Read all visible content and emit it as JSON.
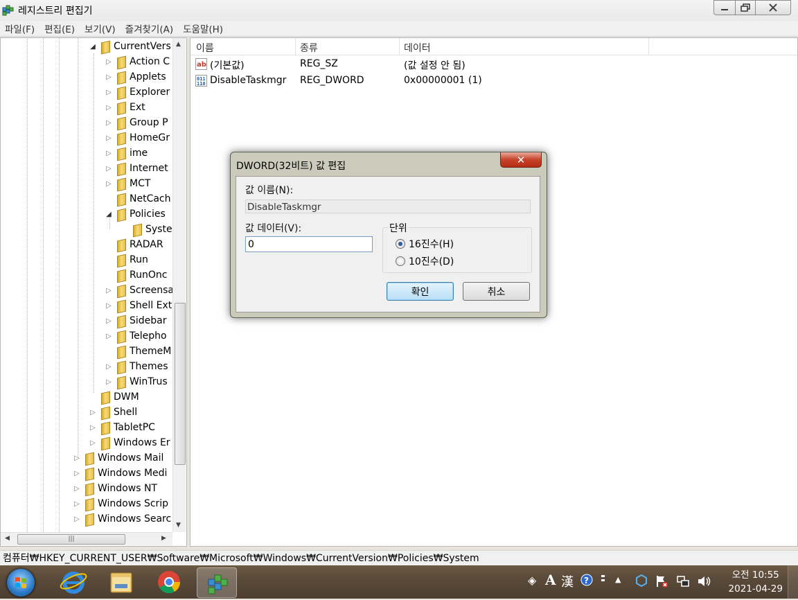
{
  "window": {
    "title": "레지스트리 편집기"
  },
  "menu": [
    "파일(F)",
    "편집(E)",
    "보기(V)",
    "즐겨찾기(A)",
    "도움말(H)"
  ],
  "tree": {
    "items": [
      {
        "label": "CurrentVers",
        "level": 2,
        "state": "expanded"
      },
      {
        "label": "Action C",
        "level": 3,
        "state": "collapsed"
      },
      {
        "label": "Applets",
        "level": 3,
        "state": "collapsed"
      },
      {
        "label": "Explorer",
        "level": 3,
        "state": "collapsed"
      },
      {
        "label": "Ext",
        "level": 3,
        "state": "collapsed"
      },
      {
        "label": "Group P",
        "level": 3,
        "state": "collapsed"
      },
      {
        "label": "HomeGr",
        "level": 3,
        "state": "collapsed"
      },
      {
        "label": "ime",
        "level": 3,
        "state": "collapsed"
      },
      {
        "label": "Internet",
        "level": 3,
        "state": "collapsed"
      },
      {
        "label": "MCT",
        "level": 3,
        "state": "collapsed"
      },
      {
        "label": "NetCach",
        "level": 3,
        "state": "none"
      },
      {
        "label": "Policies",
        "level": 3,
        "state": "expanded"
      },
      {
        "label": "Syste",
        "level": 4,
        "state": "none",
        "selected": true
      },
      {
        "label": "RADAR",
        "level": 3,
        "state": "none"
      },
      {
        "label": "Run",
        "level": 3,
        "state": "none"
      },
      {
        "label": "RunOnc",
        "level": 3,
        "state": "none"
      },
      {
        "label": "Screensa",
        "level": 3,
        "state": "collapsed"
      },
      {
        "label": "Shell Ext",
        "level": 3,
        "state": "collapsed"
      },
      {
        "label": "Sidebar",
        "level": 3,
        "state": "collapsed"
      },
      {
        "label": "Telepho",
        "level": 3,
        "state": "collapsed"
      },
      {
        "label": "ThemeM",
        "level": 3,
        "state": "none"
      },
      {
        "label": "Themes",
        "level": 3,
        "state": "collapsed"
      },
      {
        "label": "WinTrus",
        "level": 3,
        "state": "collapsed"
      },
      {
        "label": "DWM",
        "level": 2,
        "state": "none"
      },
      {
        "label": "Shell",
        "level": 2,
        "state": "collapsed"
      },
      {
        "label": "TabletPC",
        "level": 2,
        "state": "collapsed"
      },
      {
        "label": "Windows Er",
        "level": 2,
        "state": "collapsed"
      },
      {
        "label": "Windows Mail",
        "level": 1,
        "state": "collapsed"
      },
      {
        "label": "Windows Medi",
        "level": 1,
        "state": "collapsed"
      },
      {
        "label": "Windows NT",
        "level": 1,
        "state": "collapsed"
      },
      {
        "label": "Windows Scrip",
        "level": 1,
        "state": "collapsed"
      },
      {
        "label": "Windows Searc",
        "level": 1,
        "state": "collapsed"
      }
    ]
  },
  "list": {
    "columns": [
      "이름",
      "종류",
      "데이터"
    ],
    "rows": [
      {
        "name": "(기본값)",
        "type": "REG_SZ",
        "data": "(값 설정 안 됨)",
        "icon": "string-value-icon"
      },
      {
        "name": "DisableTaskmgr",
        "type": "REG_DWORD",
        "data": "0x00000001 (1)",
        "icon": "dword-value-icon"
      }
    ]
  },
  "status": {
    "path": "컴퓨터₩HKEY_CURRENT_USER₩Software₩Microsoft₩Windows₩CurrentVersion₩Policies₩System"
  },
  "dialog": {
    "title": "DWORD(32비트) 값 편집",
    "close_glyph": "✕",
    "name_label": "값 이름(N):",
    "name_value": "DisableTaskmgr",
    "data_label": "값 데이터(V):",
    "data_value": "0",
    "base_label": "단위",
    "hex_label": "16진수(H)",
    "dec_label": "10진수(D)",
    "ok_label": "확인",
    "cancel_label": "취소",
    "selected_base": "hex"
  },
  "taskbar": {
    "time": "오전 10:55",
    "date": "2021-04-29",
    "ime_a": "A",
    "ime_han": "漢"
  },
  "colors": {
    "accent": "#3c7fb1",
    "close": "#c7432b"
  }
}
